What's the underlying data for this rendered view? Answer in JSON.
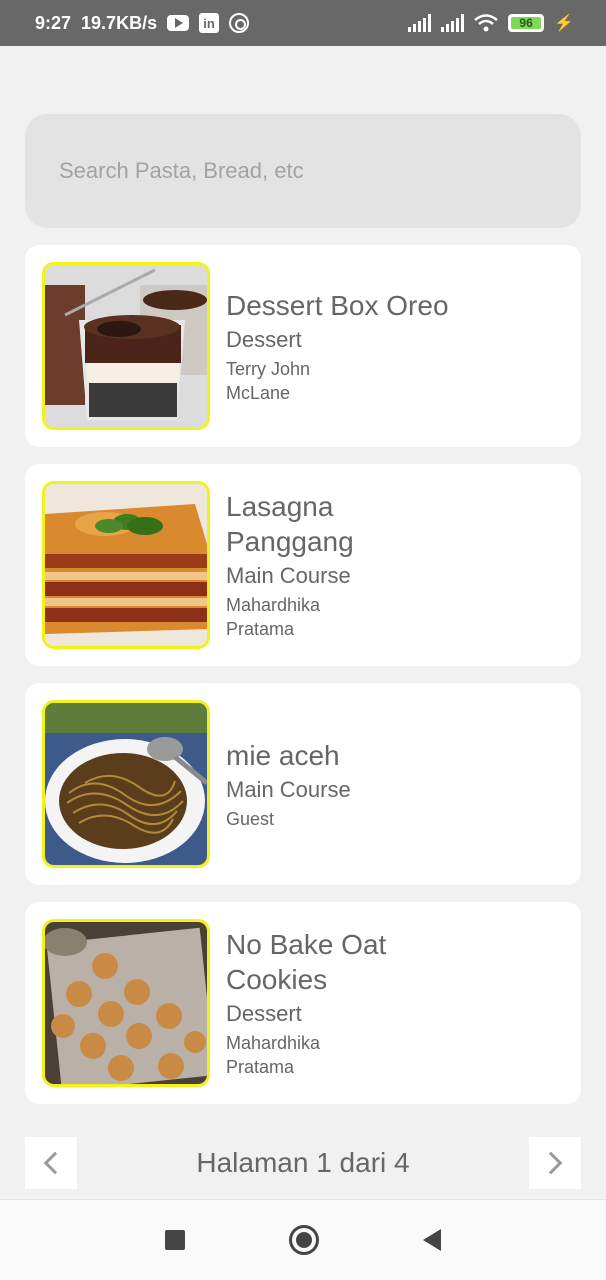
{
  "status_bar": {
    "time": "9:27",
    "speed": "19.7KB/s",
    "battery": "96"
  },
  "search": {
    "placeholder": "Search Pasta, Bread, etc"
  },
  "recipes": [
    {
      "title": "Dessert Box Oreo",
      "category": "Dessert",
      "author": "Terry John McLane",
      "image": "dessert-box-oreo-photo"
    },
    {
      "title": "Lasagna Panggang",
      "category": "Main Course",
      "author": "Mahardhika Pratama",
      "image": "lasagna-photo"
    },
    {
      "title": "mie aceh",
      "category": "Main Course",
      "author": "Guest",
      "image": "mie-aceh-photo"
    },
    {
      "title": "No Bake Oat Cookies",
      "category": "Dessert",
      "author": "Mahardhika Pratama",
      "image": "oat-cookies-photo"
    }
  ],
  "pagination": {
    "label": "Halaman 1 dari 4"
  },
  "colors": {
    "thumb_border": "#f2f21a",
    "background": "#f1f1f1"
  }
}
